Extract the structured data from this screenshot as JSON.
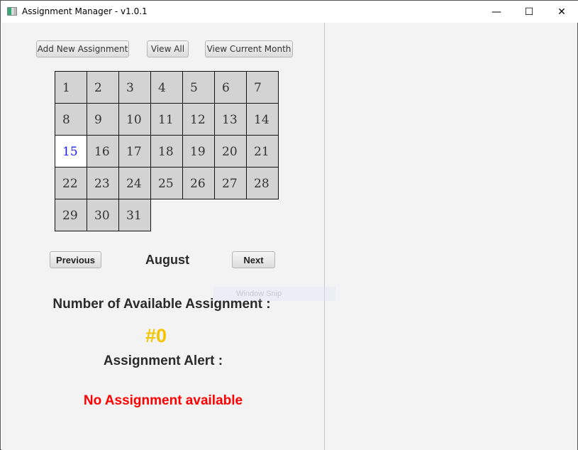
{
  "window": {
    "title": "Assignment Manager - v1.0.1",
    "minimize": "—",
    "maximize": "☐",
    "close": "✕"
  },
  "toolbar": {
    "add": "Add New Assignment",
    "view_all": "View All",
    "view_month": "View Current Month"
  },
  "calendar": {
    "days": [
      "1",
      "2",
      "3",
      "4",
      "5",
      "6",
      "7",
      "8",
      "9",
      "10",
      "11",
      "12",
      "13",
      "14",
      "15",
      "16",
      "17",
      "18",
      "19",
      "20",
      "21",
      "22",
      "23",
      "24",
      "25",
      "26",
      "27",
      "28",
      "29",
      "30",
      "31"
    ],
    "today": "15",
    "month": "August",
    "prev": "Previous",
    "next": "Next"
  },
  "summary": {
    "count_label": "Number of Available Assignment :",
    "count": "#0",
    "alert_label": "Assignment Alert :",
    "alert": "No Assignment available"
  },
  "overlay": {
    "snip": "Window Snip"
  },
  "colors": {
    "count": "#f5c400",
    "alert": "#ff0000",
    "today": "#1a1aff"
  }
}
